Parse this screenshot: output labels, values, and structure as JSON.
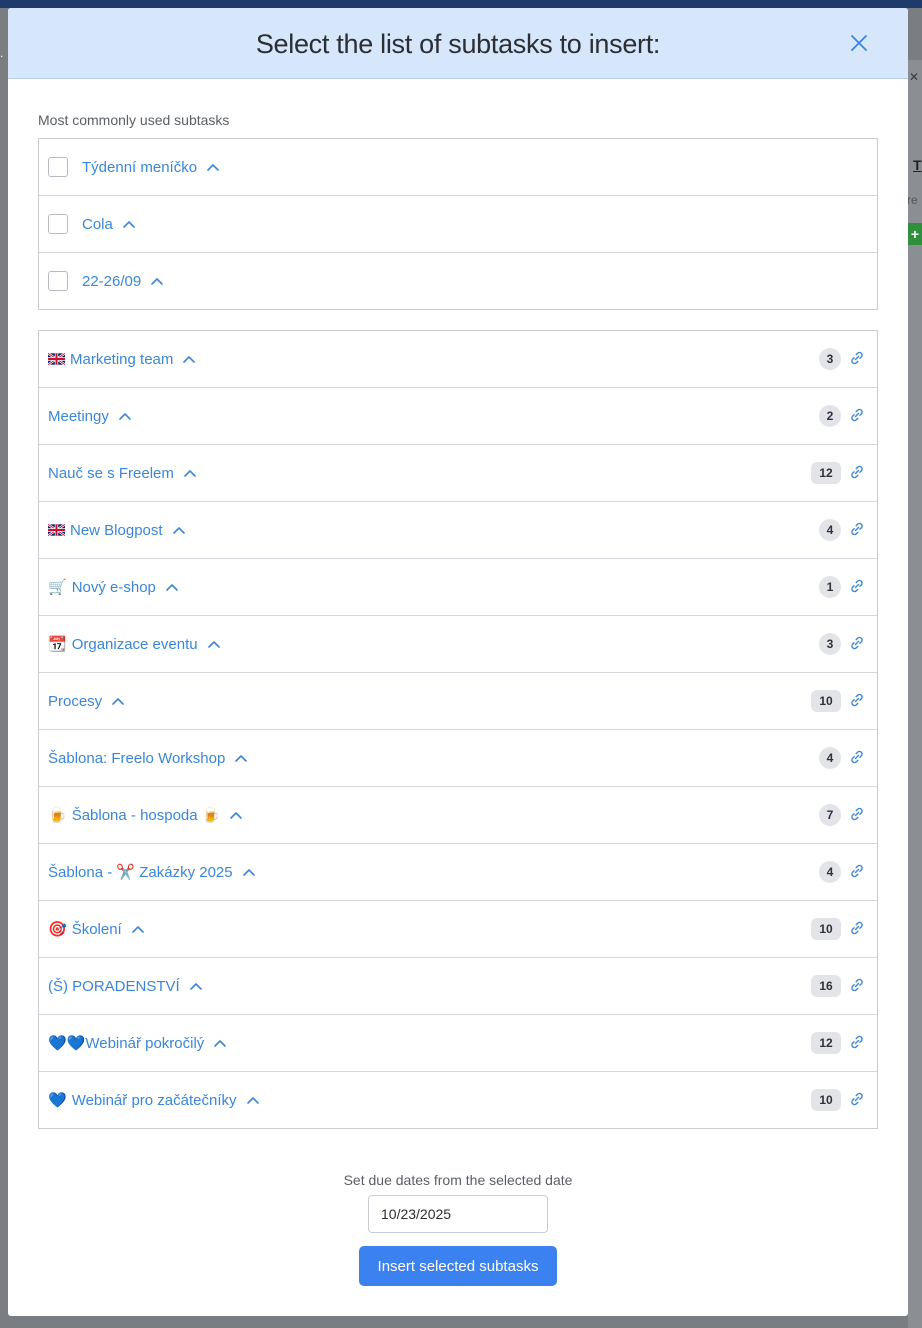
{
  "modal": {
    "title": "Select the list of subtasks to insert:",
    "close_icon": "close-icon"
  },
  "common": {
    "label": "Most commonly used subtasks",
    "items": [
      {
        "label": "Týdenní meníčko"
      },
      {
        "label": "Cola"
      },
      {
        "label": "22-26/09"
      }
    ]
  },
  "templates": [
    {
      "emoji": "uk-flag-icon",
      "label": "Marketing team",
      "count": "3"
    },
    {
      "emoji": "",
      "label": "Meetingy",
      "count": "2"
    },
    {
      "emoji": "",
      "label": "Nauč se s Freelem",
      "count": "12"
    },
    {
      "emoji": "uk-flag-icon",
      "label": "New Blogpost",
      "count": "4"
    },
    {
      "emoji": "🛒",
      "label": "Nový e-shop",
      "count": "1"
    },
    {
      "emoji": "📆",
      "label": "Organizace eventu",
      "count": "3"
    },
    {
      "emoji": "",
      "label": "Procesy",
      "count": "10"
    },
    {
      "emoji": "",
      "label": "Šablona: Freelo Workshop",
      "count": "4"
    },
    {
      "emoji": "🍺",
      "label": "Šablona - hospoda 🍺",
      "count": "7"
    },
    {
      "emoji": "",
      "label": "Šablona - ✂️ Zakázky 2025",
      "count": "4"
    },
    {
      "emoji": "🎯",
      "label": "Školení",
      "count": "10"
    },
    {
      "emoji": "",
      "label": "(Š) PORADENSTVÍ",
      "count": "16"
    },
    {
      "emoji": "",
      "label": "💙💙Webinář pokročilý",
      "count": "12"
    },
    {
      "emoji": "💙",
      "label": "Webinář pro začátečníky",
      "count": "10"
    }
  ],
  "footer": {
    "due_label": "Set due dates from the selected date",
    "date_value": "10/23/2025",
    "insert_label": "Insert selected subtasks"
  },
  "colors": {
    "accent": "#3b82f0",
    "link": "#3b86d8",
    "header_bg": "#d6e7fb"
  }
}
